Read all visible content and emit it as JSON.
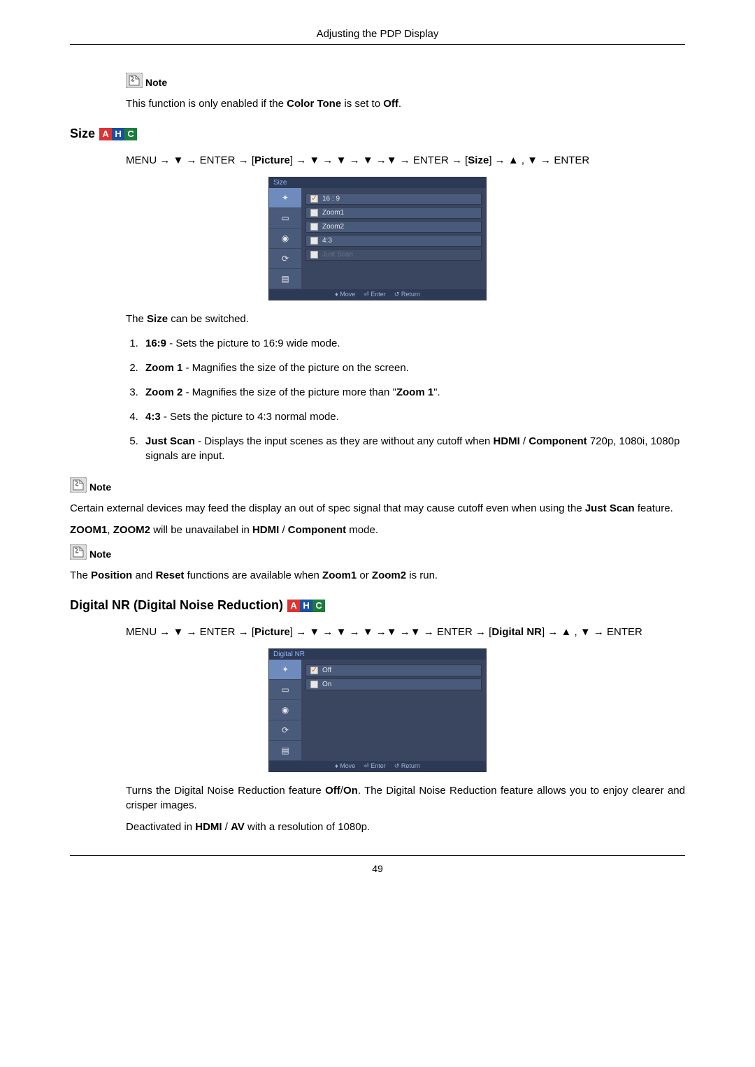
{
  "header": "Adjusting the PDP Display",
  "page_number": "49",
  "note_label": "Note",
  "note_text_1_parts": [
    "This function is only enabled if the ",
    "Color Tone",
    " is set to ",
    "Off",
    "."
  ],
  "size": {
    "title": "Size",
    "nav_parts": [
      "MENU → ▼ → ENTER → [",
      "Picture",
      "] → ▼ → ▼ → ▼ →▼ → ENTER → [",
      "Size",
      "] → ▲ , ▼ → ENTER"
    ],
    "osd": {
      "title": "Size",
      "items": [
        {
          "label": "16 : 9",
          "selected": true,
          "disabled": false
        },
        {
          "label": "Zoom1",
          "selected": false,
          "disabled": false
        },
        {
          "label": "Zoom2",
          "selected": false,
          "disabled": false
        },
        {
          "label": "4:3",
          "selected": false,
          "disabled": false
        },
        {
          "label": "Just Scan",
          "selected": false,
          "disabled": true
        }
      ],
      "footer": {
        "move": "Move",
        "enter": "Enter",
        "return": "Return"
      }
    },
    "intro_parts": [
      "The ",
      "Size",
      " can be switched."
    ],
    "options": [
      {
        "b": "16:9",
        "t": " - Sets the picture to 16:9 wide mode."
      },
      {
        "b": "Zoom 1",
        "t": " - Magnifies the size of the picture on the screen."
      },
      {
        "b": "Zoom 2",
        "t_parts": [
          " - Magnifies the size of the picture more than \"",
          "Zoom 1",
          "\"."
        ]
      },
      {
        "b": "4:3",
        "t": " - Sets the picture to 4:3 normal mode."
      },
      {
        "b": "Just Scan",
        "t_parts": [
          " - Displays the input scenes as they are without any cutoff when ",
          "HDMI",
          " / ",
          "Component",
          " 720p, 1080i, 1080p signals are input."
        ]
      }
    ],
    "note_a_parts": [
      "Certain external devices may feed the display an out of spec signal that may cause cutoff even when using the ",
      "Just Scan",
      " feature."
    ],
    "note_b_parts": [
      "ZOOM1",
      ", ",
      "ZOOM2",
      " will be unavailabel in ",
      "HDMI",
      " / ",
      "Component",
      " mode."
    ],
    "note_c_parts": [
      "The ",
      "Position",
      " and ",
      "Reset",
      " functions are available when ",
      "Zoom1",
      " or ",
      "Zoom2",
      " is run."
    ]
  },
  "dnr": {
    "title": "Digital NR (Digital Noise Reduction)",
    "nav_parts": [
      "MENU → ▼ → ENTER → [",
      "Picture",
      "] → ▼ → ▼ → ▼ →▼ →▼ → ENTER → [",
      "Digital NR",
      "] → ▲ , ▼ → ENTER"
    ],
    "osd": {
      "title": "Digital  NR",
      "items": [
        {
          "label": "Off",
          "selected": true,
          "disabled": false
        },
        {
          "label": "On",
          "selected": false,
          "disabled": false
        }
      ],
      "footer": {
        "move": "Move",
        "enter": "Enter",
        "return": "Return"
      }
    },
    "desc_parts": [
      "Turns the Digital Noise Reduction feature ",
      "Off",
      "/",
      "On",
      ". The Digital Noise Reduction feature allows you to enjoy clearer and crisper images."
    ],
    "deact_parts": [
      "Deactivated in ",
      "HDMI",
      " / ",
      "AV",
      " with a resolution of 1080p."
    ]
  }
}
